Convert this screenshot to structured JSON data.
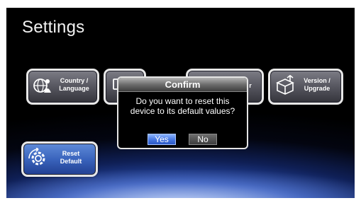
{
  "screen": {
    "title": "Settings"
  },
  "tiles": [
    {
      "id": "country-language",
      "line1": "Country /",
      "line2": "Language",
      "icon": "globe-person-icon"
    },
    {
      "id": "hidden-2",
      "line1": "",
      "line2": "",
      "icon": "monitor-icon"
    },
    {
      "id": "hidden-3",
      "line1": "",
      "line2": "r",
      "icon": ""
    },
    {
      "id": "version-upgrade",
      "line1": "Version /",
      "line2": "Upgrade",
      "icon": "box-upgrade-icon"
    },
    {
      "id": "reset-default",
      "line1": "Reset",
      "line2": "Default",
      "icon": "gear-reset-icon"
    }
  ],
  "dialog": {
    "title": "Confirm",
    "message_line1": "Do you want to reset this",
    "message_line2": "device to its default values?",
    "yes_label": "Yes",
    "no_label": "No"
  },
  "colors": {
    "selected_button": "#4a7be3",
    "tile_border": "#e8e8e8",
    "background": "#000000"
  }
}
